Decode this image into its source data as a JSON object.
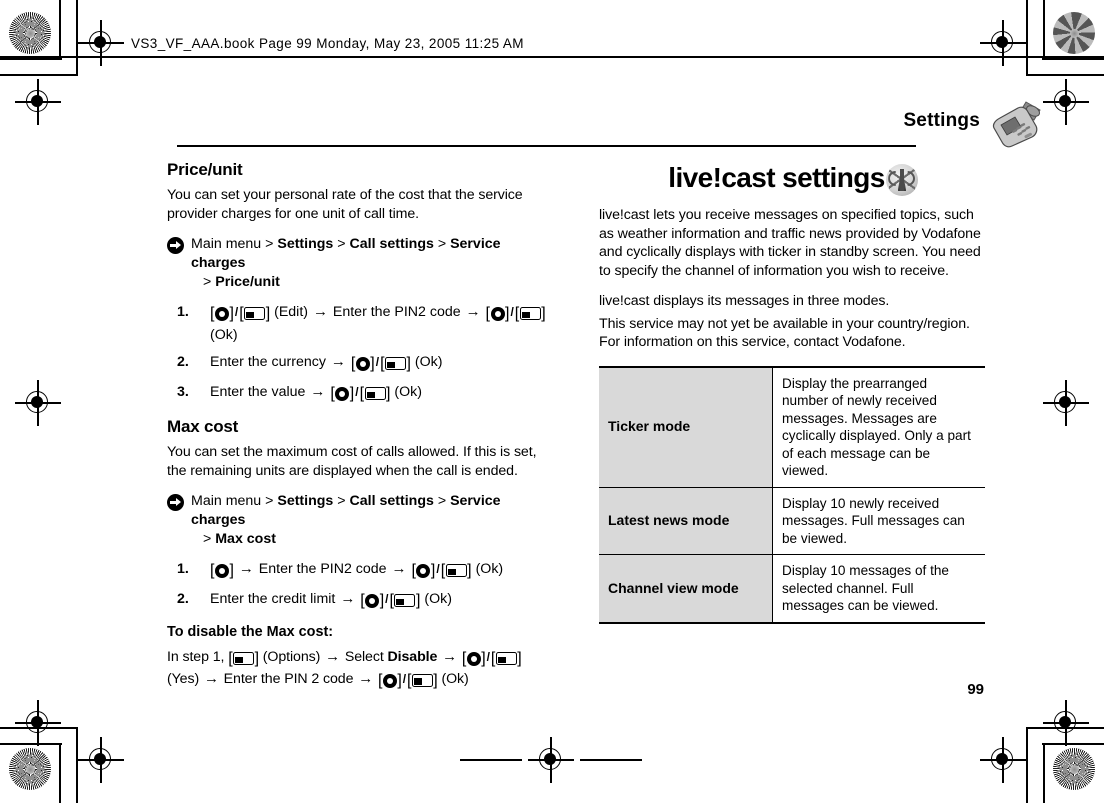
{
  "print_marks": {
    "book_info": "VS3_VF_AAA.book  Page 99  Monday, May 23, 2005  11:25 AM",
    "rosette_icon": "registration-rosette-icon",
    "crosshair_icon": "registration-crosshair-icon"
  },
  "running_head": {
    "title": "Settings",
    "phone_icon": "mobile-phone-icon"
  },
  "folio": {
    "page_number": "99"
  },
  "icons": {
    "nav_arrow": "arrow-in-circle-icon",
    "center_key": "center-select-key-icon",
    "soft_key": "left-soft-key-icon",
    "livecast": "livecast-broadcast-tower-icon"
  },
  "left_column": {
    "sections": [
      {
        "title": "Price/unit",
        "body": "You can set your personal rate of the cost that the service provider charges for one unit of call time.",
        "nav_path": {
          "prefix": "Main menu",
          "items": [
            "Settings",
            "Call settings",
            "Service charges"
          ],
          "continuation": "Price/unit",
          "separator": ">"
        },
        "steps": [
          {
            "num": "1.",
            "parts": [
              {
                "t": "key-center"
              },
              {
                "t": "slash",
                "v": "/"
              },
              {
                "t": "key-soft"
              },
              {
                "t": "text",
                "v": " (Edit) "
              },
              {
                "t": "arrow"
              },
              {
                "t": "text",
                "v": " Enter the PIN2 code "
              },
              {
                "t": "arrow"
              },
              {
                "t": "text",
                "v": " "
              },
              {
                "t": "key-center"
              },
              {
                "t": "slash",
                "v": "/"
              },
              {
                "t": "key-soft"
              },
              {
                "t": "text",
                "v": " (Ok)"
              }
            ]
          },
          {
            "num": "2.",
            "parts": [
              {
                "t": "text",
                "v": "Enter the currency "
              },
              {
                "t": "arrow"
              },
              {
                "t": "text",
                "v": " "
              },
              {
                "t": "key-center"
              },
              {
                "t": "slash",
                "v": "/"
              },
              {
                "t": "key-soft"
              },
              {
                "t": "text",
                "v": " (Ok)"
              }
            ]
          },
          {
            "num": "3.",
            "parts": [
              {
                "t": "text",
                "v": "Enter the value "
              },
              {
                "t": "arrow"
              },
              {
                "t": "text",
                "v": " "
              },
              {
                "t": "key-center"
              },
              {
                "t": "slash",
                "v": "/"
              },
              {
                "t": "key-soft"
              },
              {
                "t": "text",
                "v": " (Ok)"
              }
            ]
          }
        ]
      },
      {
        "title": "Max cost",
        "body": "You can set the maximum cost of calls allowed. If this is set, the remaining units are displayed when the call is ended.",
        "nav_path": {
          "prefix": "Main menu",
          "items": [
            "Settings",
            "Call settings",
            "Service charges"
          ],
          "continuation": "Max cost",
          "separator": ">"
        },
        "steps": [
          {
            "num": "1.",
            "parts": [
              {
                "t": "key-center"
              },
              {
                "t": "text",
                "v": " "
              },
              {
                "t": "arrow"
              },
              {
                "t": "text",
                "v": " Enter the PIN2 code "
              },
              {
                "t": "arrow"
              },
              {
                "t": "text",
                "v": " "
              },
              {
                "t": "key-center"
              },
              {
                "t": "slash",
                "v": "/"
              },
              {
                "t": "key-soft"
              },
              {
                "t": "text",
                "v": " (Ok)"
              }
            ]
          },
          {
            "num": "2.",
            "parts": [
              {
                "t": "text",
                "v": "Enter the credit limit "
              },
              {
                "t": "arrow"
              },
              {
                "t": "text",
                "v": " "
              },
              {
                "t": "key-center"
              },
              {
                "t": "slash",
                "v": "/"
              },
              {
                "t": "key-soft"
              },
              {
                "t": "text",
                "v": " (Ok)"
              }
            ]
          }
        ],
        "sub_section": {
          "title": "To disable the Max cost:",
          "parts": [
            {
              "t": "text",
              "v": "In step 1, "
            },
            {
              "t": "key-soft"
            },
            {
              "t": "text",
              "v": " (Options) "
            },
            {
              "t": "arrow"
            },
            {
              "t": "text",
              "v": " Select "
            },
            {
              "t": "bold",
              "v": "Disable"
            },
            {
              "t": "text",
              "v": " "
            },
            {
              "t": "arrow"
            },
            {
              "t": "text",
              "v": " "
            },
            {
              "t": "key-center"
            },
            {
              "t": "slash",
              "v": "/"
            },
            {
              "t": "key-soft"
            },
            {
              "t": "text",
              "v": " (Yes) "
            },
            {
              "t": "arrow"
            },
            {
              "t": "text",
              "v": " Enter the PIN 2 code "
            },
            {
              "t": "arrow"
            },
            {
              "t": "text",
              "v": " "
            },
            {
              "t": "key-center"
            },
            {
              "t": "slash",
              "v": "/"
            },
            {
              "t": "key-soft"
            },
            {
              "t": "text",
              "v": " (Ok)"
            }
          ]
        }
      }
    ]
  },
  "right_column": {
    "title": "live!cast settings",
    "paragraphs": [
      "live!cast lets you receive messages on specified topics, such as weather information and traffic news provided by Vodafone and cyclically displays with ticker in standby screen. You need to specify the channel of information you wish to receive.",
      "live!cast displays its messages in three modes.",
      "This service may not yet be available in your country/region. For information on this service, contact Vodafone."
    ],
    "table": {
      "rows": [
        {
          "mode": "Ticker mode",
          "description": "Display the prearranged number of newly received messages. Messages are cyclically displayed. Only a part of each message can be viewed."
        },
        {
          "mode": "Latest news mode",
          "description": "Display 10 newly received messages. Full messages can be viewed."
        },
        {
          "mode": "Channel view mode",
          "description": "Display 10 messages of the selected channel. Full messages can be viewed."
        }
      ]
    }
  }
}
